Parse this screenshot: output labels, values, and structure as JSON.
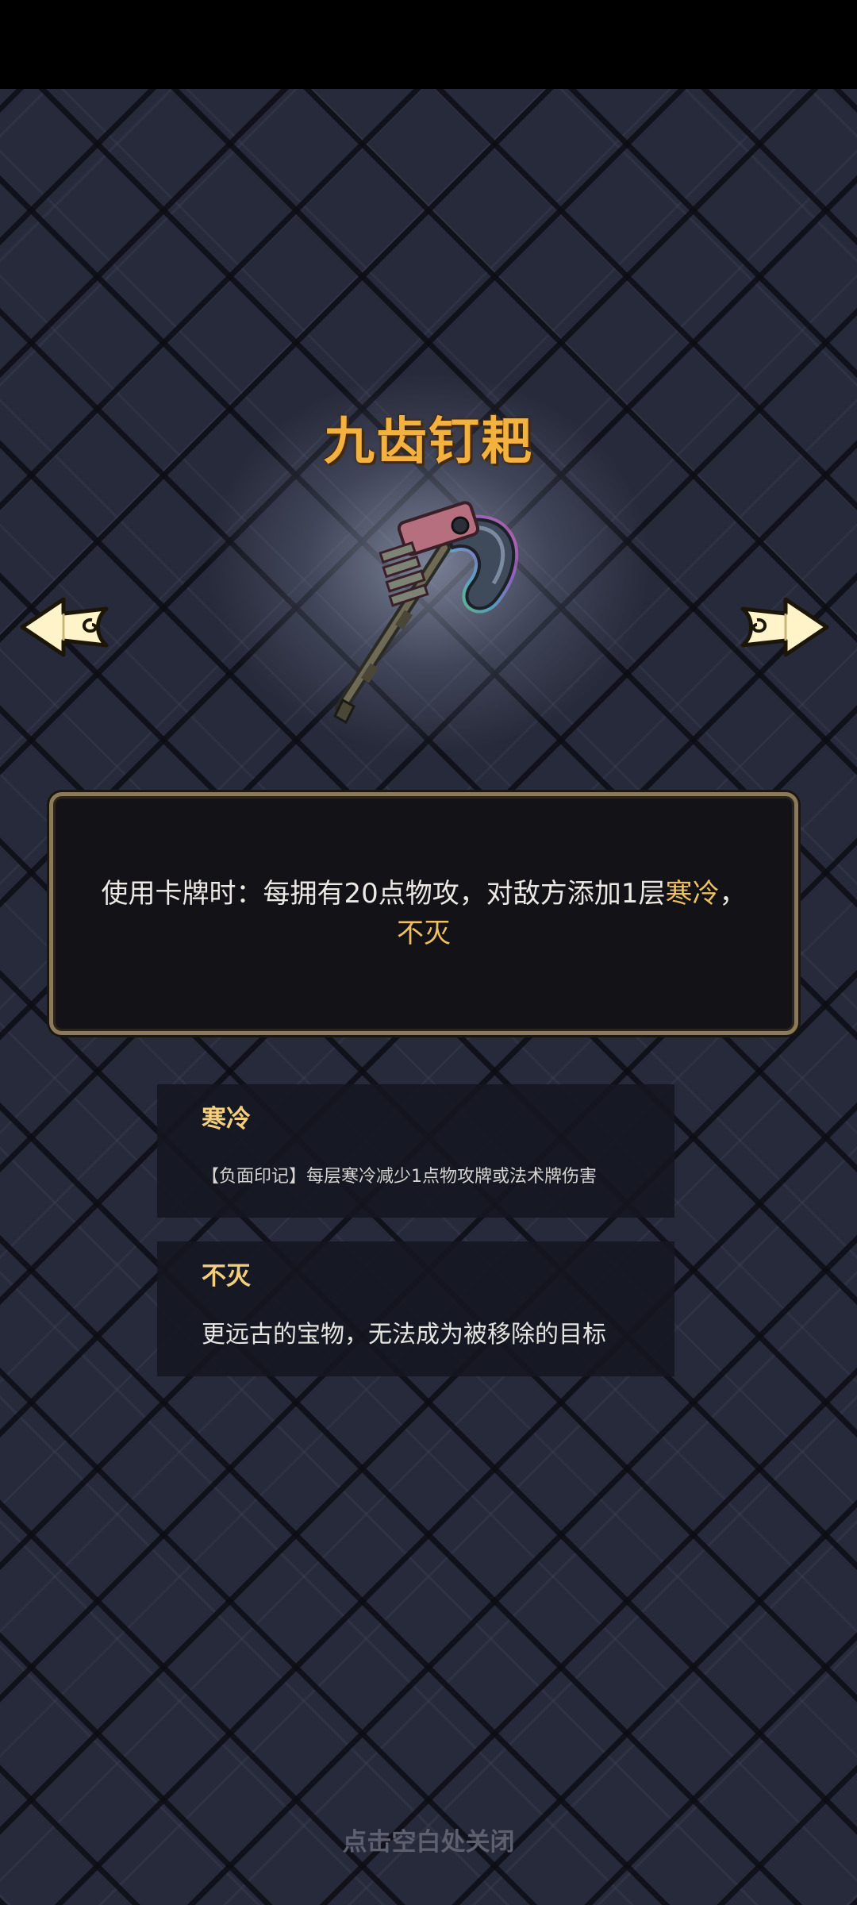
{
  "item": {
    "name": "九齿钉耙",
    "icon": "nine-tooth-rake-icon"
  },
  "description": {
    "prefix": "使用卡牌时：每拥有20点物攻，对敌方添加1层",
    "keyword1": "寒冷",
    "separator": "，",
    "keyword2": "不灭"
  },
  "keywords": [
    {
      "title": "寒冷",
      "body": "【负面印记】每层寒冷减少1点物攻牌或法术牌伤害"
    },
    {
      "title": "不灭",
      "body": "更远古的宝物，无法成为被移除的目标"
    }
  ],
  "footer": {
    "close_hint": "点击空白处关闭"
  },
  "colors": {
    "title": "#f3b23f",
    "keyword": "#f0c060",
    "background": "#272a3a",
    "panel_border": "#8c7a5a"
  }
}
